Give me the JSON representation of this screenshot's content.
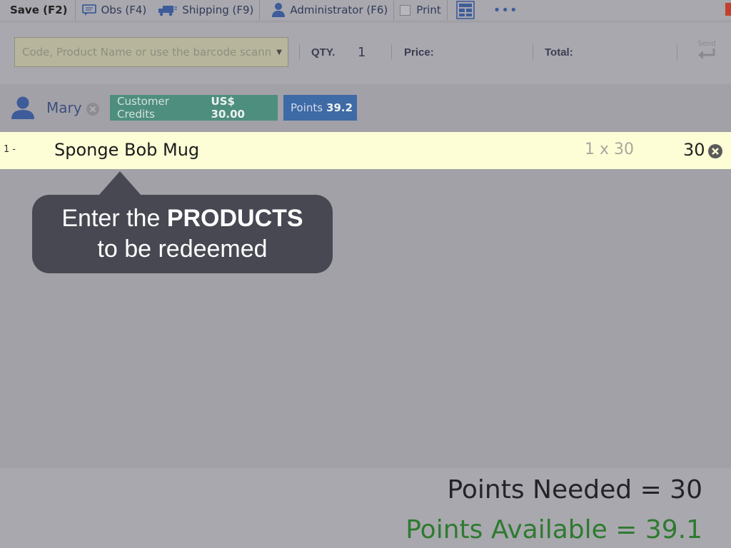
{
  "toolbar": {
    "save_label": "Save (F2)",
    "obs_label": "Obs (F4)",
    "shipping_label": "Shipping (F9)",
    "admin_label": "Administrator (F6)",
    "print_label": "Print",
    "more_label": "•••"
  },
  "entry": {
    "search_placeholder": "Code, Product Name or use the barcode scanner",
    "qty_label": "QTY.",
    "qty_value": "1",
    "price_label": "Price:",
    "total_label": "Total:",
    "send_label": "Send"
  },
  "customer": {
    "name": "Mary",
    "credits_label": "Customer Credits",
    "credits_value": "US$ 30.00",
    "points_label": "Points",
    "points_value": "39.2"
  },
  "items": [
    {
      "index": "1 -",
      "name": "Sponge Bob Mug",
      "qty_price": "1 x 30",
      "total": "30"
    }
  ],
  "callout": {
    "line1_prefix": "Enter the",
    "line1_bold": "PRODUCTS",
    "line2": "to be redeemed"
  },
  "summary": {
    "points_needed": "Points Needed = 30",
    "points_available": "Points Available = 39.1"
  },
  "colors": {
    "credits_badge": "#4e8e7e",
    "points_badge": "#3e6aa6",
    "item_row": "#fdfdd6",
    "points_available_text": "#2e7a30"
  }
}
